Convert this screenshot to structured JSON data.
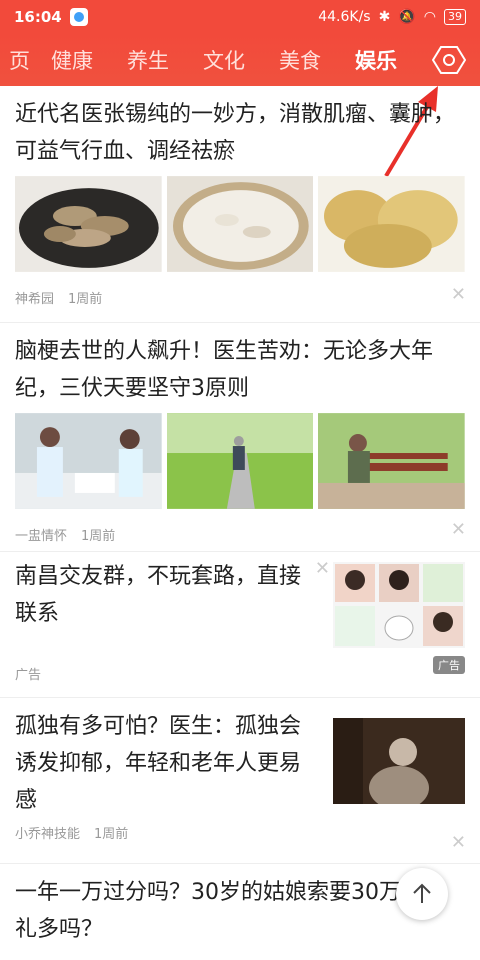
{
  "statusbar": {
    "time": "16:04",
    "network_speed": "44.6K/s",
    "battery": "39"
  },
  "tabs": [
    {
      "label": "页"
    },
    {
      "label": "健康"
    },
    {
      "label": "养生"
    },
    {
      "label": "文化"
    },
    {
      "label": "美食"
    },
    {
      "label": "娱乐"
    }
  ],
  "active_tab": "娱乐",
  "articles": [
    {
      "title": "近代名医张锡纯的一妙方，消散肌瘤、囊肿，可益气行血、调经祛瘀",
      "source": "神希园",
      "time": "1周前"
    },
    {
      "title": "脑梗去世的人飙升！医生苦劝：无论多大年纪，三伏天要坚守3原则",
      "source": "一盅情怀",
      "time": "1周前"
    },
    {
      "title": "南昌交友群，不玩套路，直接联系",
      "source": "广告",
      "ad_badge": "广告"
    },
    {
      "title": "孤独有多可怕？医生：孤独会诱发抑郁，年轻和老年人更易感",
      "source": "小乔神技能",
      "time": "1周前"
    },
    {
      "title": "一年一万过分吗？30岁的姑娘索要30万的彩礼多吗？"
    }
  ],
  "colors": {
    "brand": "#f24a3b",
    "arrow": "#e8302a"
  }
}
